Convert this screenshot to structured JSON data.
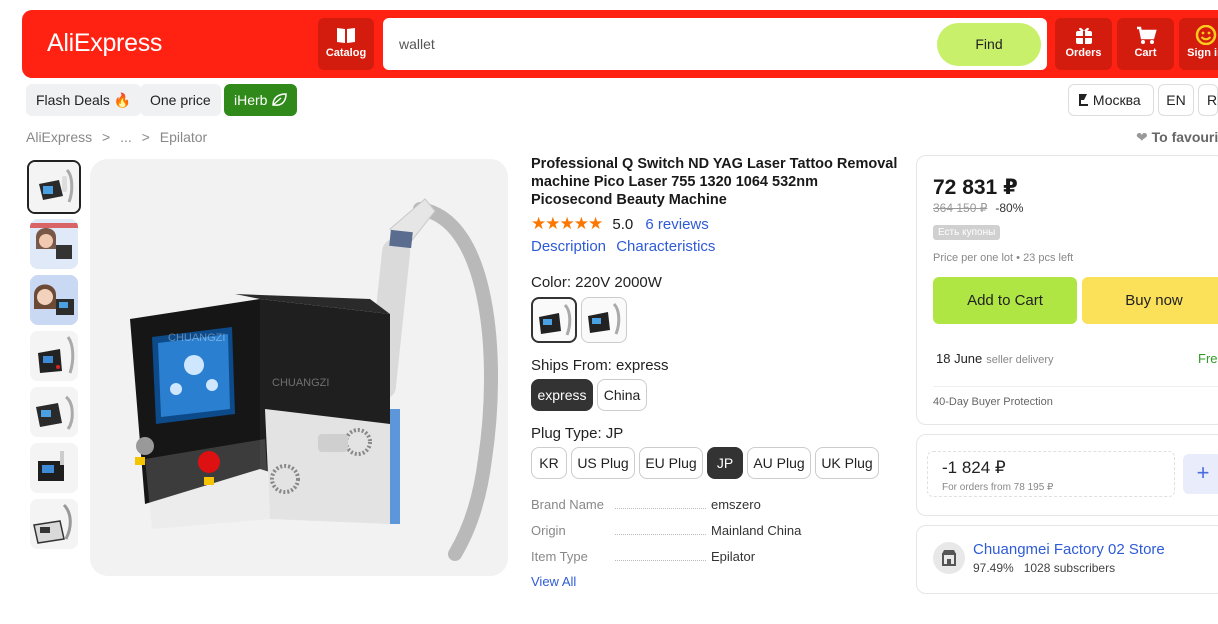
{
  "header": {
    "logo": "AliExpress",
    "catalog_label": "Catalog",
    "search_value": "wallet",
    "find_label": "Find",
    "orders_label": "Orders",
    "cart_label": "Cart",
    "signin_label": "Sign in"
  },
  "quicknav": {
    "flash_deals": "Flash Deals",
    "one_price": "One price",
    "iherb": "iHerb",
    "location": "Москва",
    "lang": "EN",
    "currency": "RU"
  },
  "breadcrumb": [
    "AliExpress",
    ">",
    "...",
    ">",
    "Epilator"
  ],
  "favourite_label": "To favourites",
  "product": {
    "title": "Professional Q Switch ND YAG Laser Tattoo Removal machine Pico Laser 755 1320 1064 532nm Picosecond Beauty Machine",
    "stars": "★★★★★",
    "rating": "5.0",
    "reviews": "6 reviews",
    "tab_description": "Description",
    "tab_characteristics": "Characteristics",
    "color_label": "Color: 220V 2000W",
    "ships_label": "Ships From: express",
    "ships_options": [
      "express",
      "China"
    ],
    "plug_label": "Plug Type: JP",
    "plug_options": [
      "KR",
      "US Plug",
      "EU Plug",
      "JP",
      "AU Plug",
      "UK Plug"
    ],
    "specs": [
      {
        "key": "Brand Name",
        "value": "emszero"
      },
      {
        "key": "Origin",
        "value": "Mainland China"
      },
      {
        "key": "Item Type",
        "value": "Epilator"
      }
    ],
    "view_all": "View All",
    "watermark": "CHUANGZI"
  },
  "buybox": {
    "price": "72 831 ₽",
    "old_price": "364 150 ₽",
    "discount": "-80%",
    "coupon_tag": "Есть купоны",
    "price_info": "Price per one lot • 23 pcs left",
    "add_to_cart": "Add to Cart",
    "buy_now": "Buy now",
    "delivery_date": "18 June",
    "delivery_note": "seller delivery",
    "free_label": "Free",
    "protection": "40-Day Buyer Protection"
  },
  "coupon": {
    "value": "-1 824 ₽",
    "note": "For orders from 78 195 ₽",
    "add_symbol": "+"
  },
  "store": {
    "name": "Chuangmei Factory 02 Store",
    "rating": "97.49%",
    "subscribers": "1028 subscribers"
  },
  "colors": {
    "brand_red": "#ff2212",
    "find_green": "#c9f06b",
    "add_to_cart": "#b0e643",
    "buy_now": "#fbe15a",
    "star_orange": "#fb7701",
    "link_blue": "#2e5bd7",
    "iherb_green": "#2f8a1a"
  }
}
